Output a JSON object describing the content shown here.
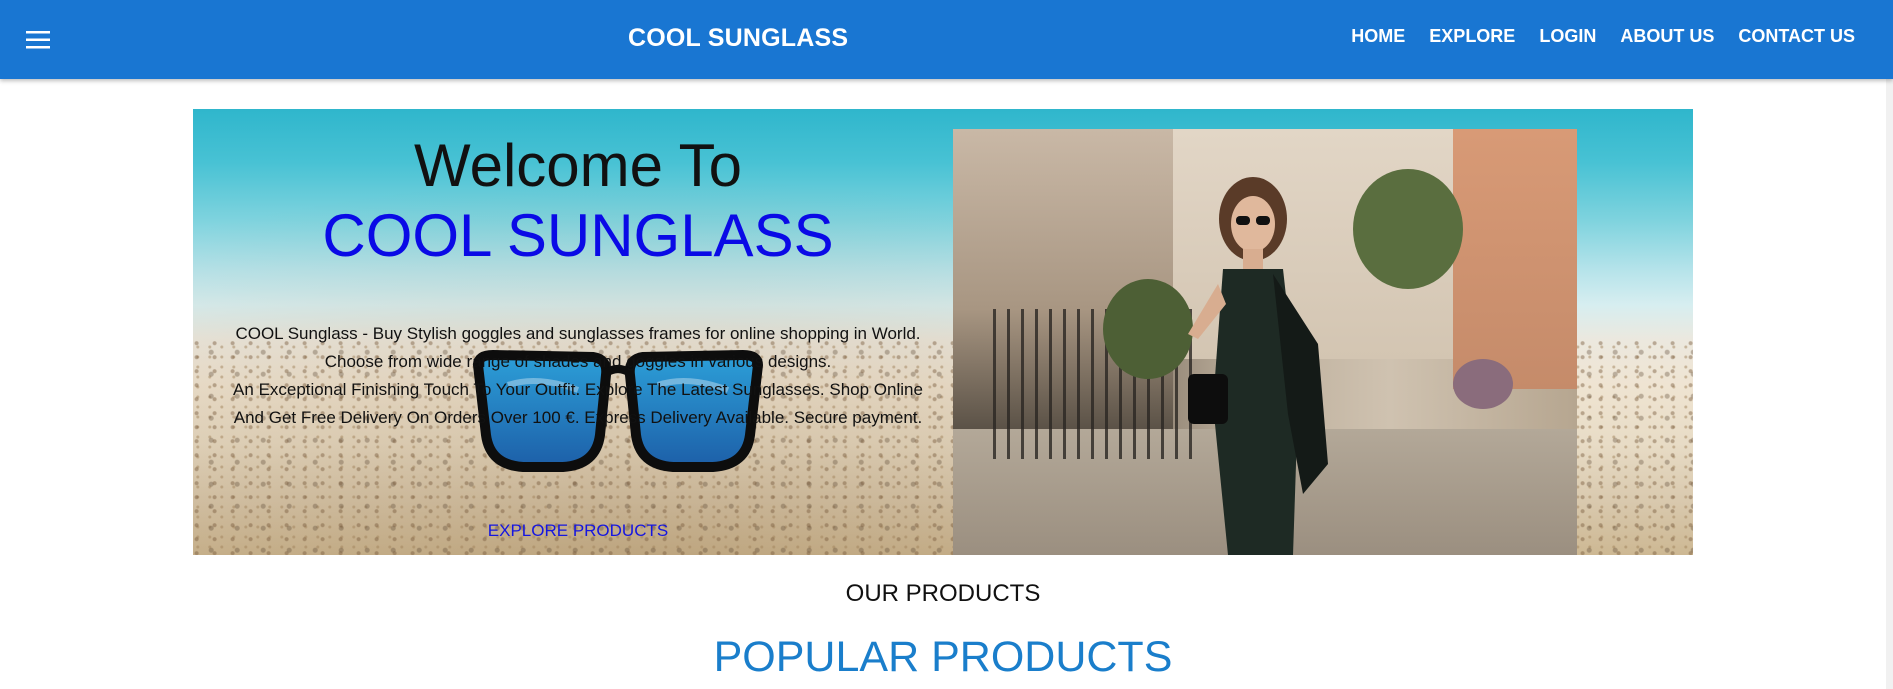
{
  "header": {
    "brand": "COOL SUNGLASS",
    "nav": [
      "HOME",
      "EXPLORE",
      "LOGIN",
      "ABOUT US",
      "CONTACT US"
    ],
    "menu_icon": "hamburger-menu-icon",
    "background_color": "#1976d2"
  },
  "hero": {
    "welcome": "Welcome To",
    "brand": "COOL SUNGLASS",
    "description_1": "COOL Sunglass - Buy Stylish goggles and sunglasses frames for online shopping in World. Choose from wide range of shades and goggles in various designs.",
    "description_2": "An Exceptional Finishing Touch To Your Outfit. Explore The Latest Sunglasses. Shop Online And Get Free Delivery On Orders Over 100 €. Express Delivery Available. Secure payment.",
    "cta": "EXPLORE PRODUCTS",
    "brand_color": "#0a0ae6"
  },
  "sections": {
    "our_products": "OUR PRODUCTS",
    "popular": "POPULAR PRODUCTS",
    "popular_color": "#1a7ecb"
  }
}
